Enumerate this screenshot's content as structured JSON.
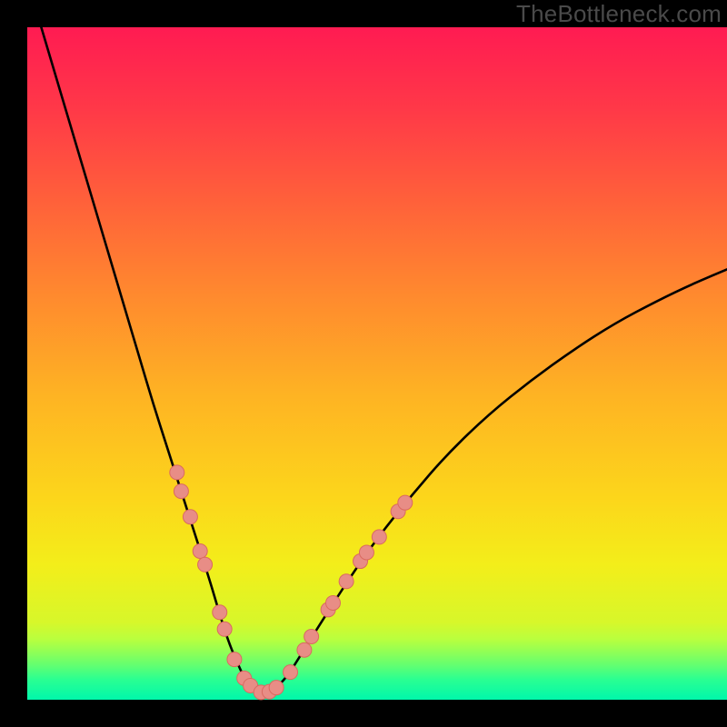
{
  "watermark": "TheBottleneck.com",
  "chart_data": {
    "type": "line",
    "title": "",
    "xlabel": "",
    "ylabel": "",
    "xlim": [
      0,
      100
    ],
    "ylim": [
      0,
      100
    ],
    "grid": false,
    "legend": false,
    "background": {
      "type": "vertical-gradient",
      "stops": [
        {
          "pos": 0,
          "color": "#ff1b52"
        },
        {
          "pos": 0.12,
          "color": "#ff3848"
        },
        {
          "pos": 0.25,
          "color": "#ff5e3b"
        },
        {
          "pos": 0.4,
          "color": "#ff8a2e"
        },
        {
          "pos": 0.55,
          "color": "#feb433"
        },
        {
          "pos": 0.7,
          "color": "#fcd61b"
        },
        {
          "pos": 0.8,
          "color": "#f3ee1a"
        },
        {
          "pos": 0.885,
          "color": "#d7f72a"
        },
        {
          "pos": 0.91,
          "color": "#b9ff3e"
        },
        {
          "pos": 0.93,
          "color": "#8eff57"
        },
        {
          "pos": 0.95,
          "color": "#5fff73"
        },
        {
          "pos": 0.97,
          "color": "#2aff92"
        },
        {
          "pos": 1.0,
          "color": "#00f7ab"
        }
      ]
    },
    "series": [
      {
        "name": "bottleneck-curve",
        "color": "#000000",
        "stroke_width": 2.5,
        "x": [
          2,
          4,
          6,
          8,
          10,
          12,
          14,
          16,
          18,
          20,
          22,
          24,
          26,
          27,
          28,
          29,
          30,
          31,
          32,
          33,
          34,
          35,
          37,
          39,
          42,
          46,
          50,
          55,
          60,
          66,
          72,
          78,
          84,
          90,
          95,
          100
        ],
        "y": [
          100,
          93,
          86,
          79,
          72,
          65,
          58,
          51,
          44,
          37.5,
          31,
          24.5,
          18,
          14.5,
          11,
          8,
          5.5,
          3.3,
          2,
          1.3,
          1,
          1.3,
          3.2,
          6.5,
          11.5,
          18,
          24,
          30.5,
          36.5,
          42.5,
          47.5,
          52,
          56,
          59.3,
          61.8,
          64
        ]
      }
    ],
    "markers": [
      {
        "name": "highlight-points",
        "shape": "circle",
        "radius": 8,
        "fill": "#e88d86",
        "stroke": "#da6a60",
        "points": [
          {
            "x": 21.4,
            "y": 33.8
          },
          {
            "x": 22.0,
            "y": 31.0
          },
          {
            "x": 23.3,
            "y": 27.2
          },
          {
            "x": 24.7,
            "y": 22.1
          },
          {
            "x": 25.4,
            "y": 20.1
          },
          {
            "x": 27.5,
            "y": 13.0
          },
          {
            "x": 28.2,
            "y": 10.5
          },
          {
            "x": 29.6,
            "y": 6.0
          },
          {
            "x": 31.0,
            "y": 3.2
          },
          {
            "x": 31.9,
            "y": 2.1
          },
          {
            "x": 33.4,
            "y": 1.1
          },
          {
            "x": 34.6,
            "y": 1.2
          },
          {
            "x": 35.6,
            "y": 1.8
          },
          {
            "x": 37.6,
            "y": 4.1
          },
          {
            "x": 39.6,
            "y": 7.4
          },
          {
            "x": 40.6,
            "y": 9.4
          },
          {
            "x": 43.0,
            "y": 13.4
          },
          {
            "x": 43.7,
            "y": 14.4
          },
          {
            "x": 45.6,
            "y": 17.6
          },
          {
            "x": 47.6,
            "y": 20.6
          },
          {
            "x": 48.5,
            "y": 21.9
          },
          {
            "x": 50.3,
            "y": 24.2
          },
          {
            "x": 53.0,
            "y": 28.0
          },
          {
            "x": 54.0,
            "y": 29.3
          }
        ]
      }
    ]
  }
}
